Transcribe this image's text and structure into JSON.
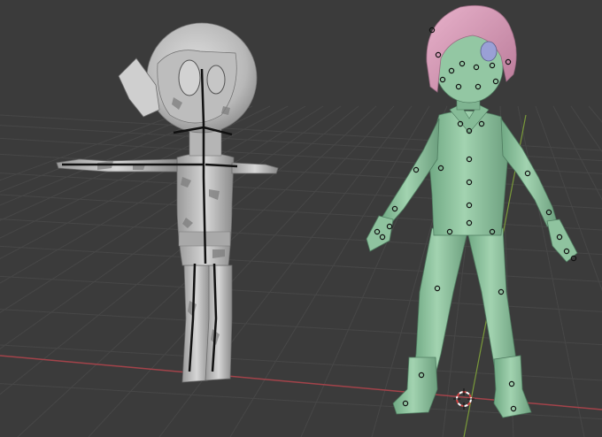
{
  "viewport": {
    "background_color": "#3b3b3b",
    "grid_color": "#474747",
    "x_axis_color": "#a3434a",
    "y_axis_color": "#7a9a3a"
  },
  "objects": [
    {
      "name": "grey-robot-character-mesh",
      "base_color": "#c4c4c4",
      "shading": "solid",
      "has_armature": true
    },
    {
      "name": "green-girl-character-mesh",
      "base_color": "#8fc39f",
      "hair_color": "#d79ab7",
      "eye_color": "#9aa0d6",
      "shading": "solid",
      "has_armature": true
    }
  ],
  "origin_marker": {
    "name": "3d-cursor",
    "colors": [
      "#d24545",
      "#ffffff"
    ]
  }
}
